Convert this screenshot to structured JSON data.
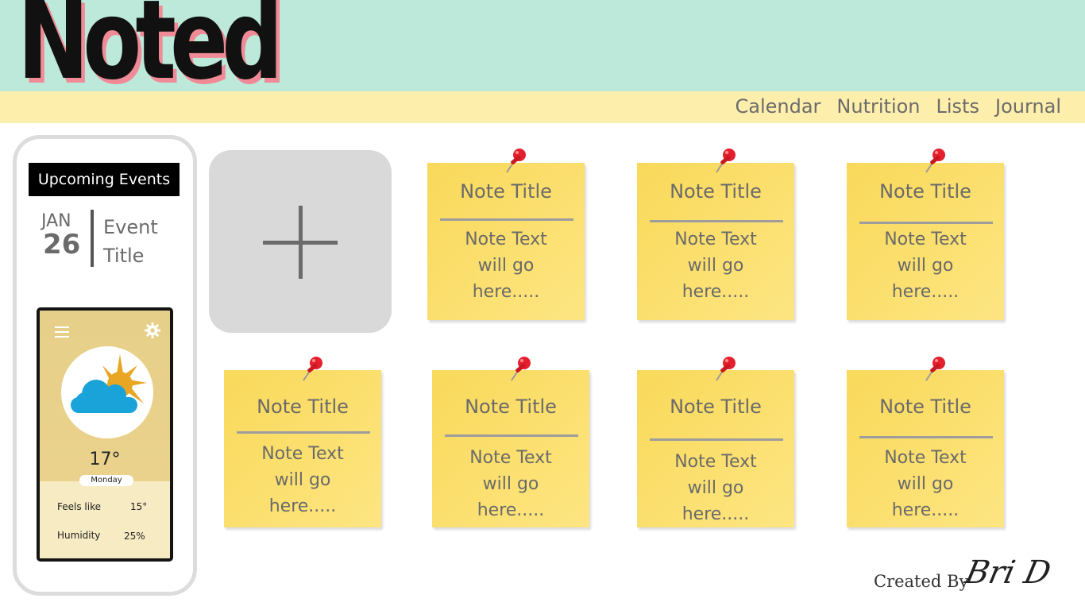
{
  "header": {
    "logo": "Noted",
    "nav": [
      "Calendar",
      "Nutrition",
      "Lists",
      "Journal"
    ]
  },
  "sidebar": {
    "events_title": "Upcoming Events",
    "event": {
      "month": "JAN",
      "day": "26",
      "title": "Event Title"
    },
    "weather": {
      "temperature": "17°",
      "day": "Monday",
      "feels_like_label": "Feels like",
      "feels_like_value": "15°",
      "humidity_label": "Humidity",
      "humidity_value": "25%",
      "icons": [
        "menu-icon",
        "gear-icon",
        "sun-cloud-icon"
      ]
    }
  },
  "add_note": {
    "icon": "plus-icon"
  },
  "notes": [
    {
      "title": "Note Title",
      "text": "Note Text will go here....."
    },
    {
      "title": "Note Title",
      "text": "Note Text will go here....."
    },
    {
      "title": "Note Title",
      "text": "Note Text will go here....."
    },
    {
      "title": "Note Title",
      "text": "Note Text will go here....."
    },
    {
      "title": "Note Title",
      "text": "Note Text will go here....."
    },
    {
      "title": "Note Title",
      "text": "Note Text will go here....."
    },
    {
      "title": "Note Title",
      "text": "Note Text will go here....."
    }
  ],
  "footer": {
    "created_by": "Created By",
    "author": "Bri D"
  },
  "colors": {
    "header_mint": "#bce9da",
    "nav_yellow": "#fdefab",
    "note_yellow": "#fbdf6c",
    "logo_shadow": "#f08a96"
  }
}
